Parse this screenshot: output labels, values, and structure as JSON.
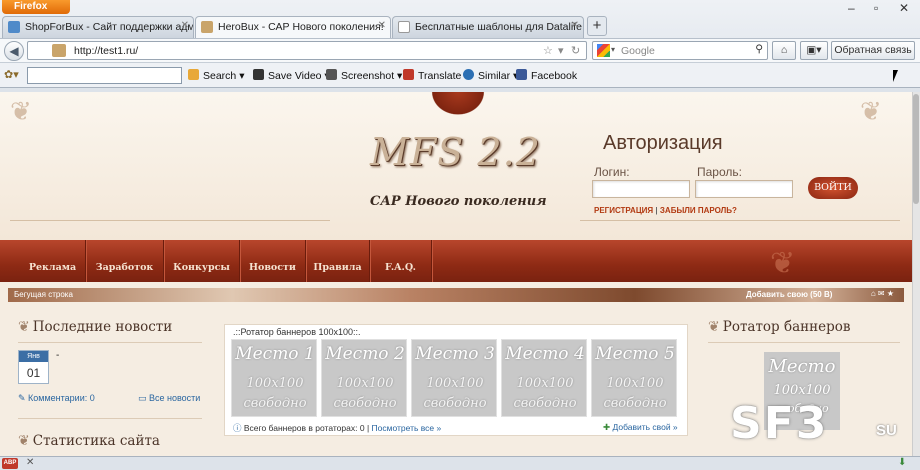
{
  "browser": {
    "app_button": "Firefox",
    "tabs": [
      {
        "label": "ShopForBux - Сайт поддержки адм…",
        "active": false
      },
      {
        "label": "HeroBux - САР Нового поколения!",
        "active": true
      },
      {
        "label": "Бесплатные шаблоны для Datalife …",
        "active": false
      }
    ],
    "new_tab": "+",
    "url": "http://test1.ru/",
    "search_placeholder": "Google",
    "feedback_button": "Обратная связь",
    "toolbar_items": [
      {
        "label": "Search",
        "icon": "search-icon",
        "color": "#e8a838"
      },
      {
        "label": "Save Video",
        "icon": "film-icon",
        "color": "#333333"
      },
      {
        "label": "Screenshot",
        "icon": "camera-icon",
        "color": "#555555"
      },
      {
        "label": "Translate",
        "icon": "translate-icon",
        "color": "#c0392b"
      },
      {
        "label": "Similar",
        "icon": "similar-icon",
        "color": "#2c6fb3"
      },
      {
        "label": "Facebook",
        "icon": "facebook-icon",
        "color": "#3b5998"
      }
    ]
  },
  "site": {
    "logo": "MFS 2.2",
    "slogan": "САР Нового поколения",
    "auth": {
      "title": "Авторизация",
      "login_label": "Логин:",
      "password_label": "Пароль:",
      "submit": "ВОЙТИ",
      "register": "РЕГИСТРАЦИЯ",
      "separator": "|",
      "forgot": "ЗАБЫЛИ ПАРОЛЬ?"
    },
    "menu": [
      "Реклама",
      "Заработок",
      "Конкурсы",
      "Новости",
      "Правила",
      "F.A.Q."
    ],
    "ticker": {
      "label": "Бегущая строка",
      "add_link": "Добавить свою (50 В)",
      "icons": "⌂ ✉ ★"
    },
    "left": {
      "news_title": "Последние новости",
      "cal_month": "Янв",
      "cal_day": "01",
      "news_text": "-",
      "comments": "Комментарии: 0",
      "all_news": "Все новости",
      "stats_title": "Статистика сайта"
    },
    "rotator": {
      "title": ".::Ротатор баннеров 100x100::.",
      "slots": [
        {
          "title": "Место 1",
          "size": "100x100",
          "status": "свободно"
        },
        {
          "title": "Место 2",
          "size": "100x100",
          "status": "свободно"
        },
        {
          "title": "Место 3",
          "size": "100x100",
          "status": "свободно"
        },
        {
          "title": "Место 4",
          "size": "100x100",
          "status": "свободно"
        },
        {
          "title": "Место 5",
          "size": "100x100",
          "status": "свободно"
        }
      ],
      "total": "Всего баннеров в ротаторах: 0",
      "separator": "|",
      "view_all": "Посмотреть все »",
      "add": "Добавить свой »"
    },
    "right": {
      "title": "Ротатор баннеров",
      "slot_title": "Место",
      "slot_size": "100x100",
      "slot_status": "свободно"
    },
    "watermark": "SF3",
    "watermark_suffix": "SU"
  },
  "statusbar": {
    "left_badge": "ABP"
  },
  "colors": {
    "menu": "#9a3219",
    "accent": "#b23a12",
    "page_bg": "#f5ede2"
  }
}
